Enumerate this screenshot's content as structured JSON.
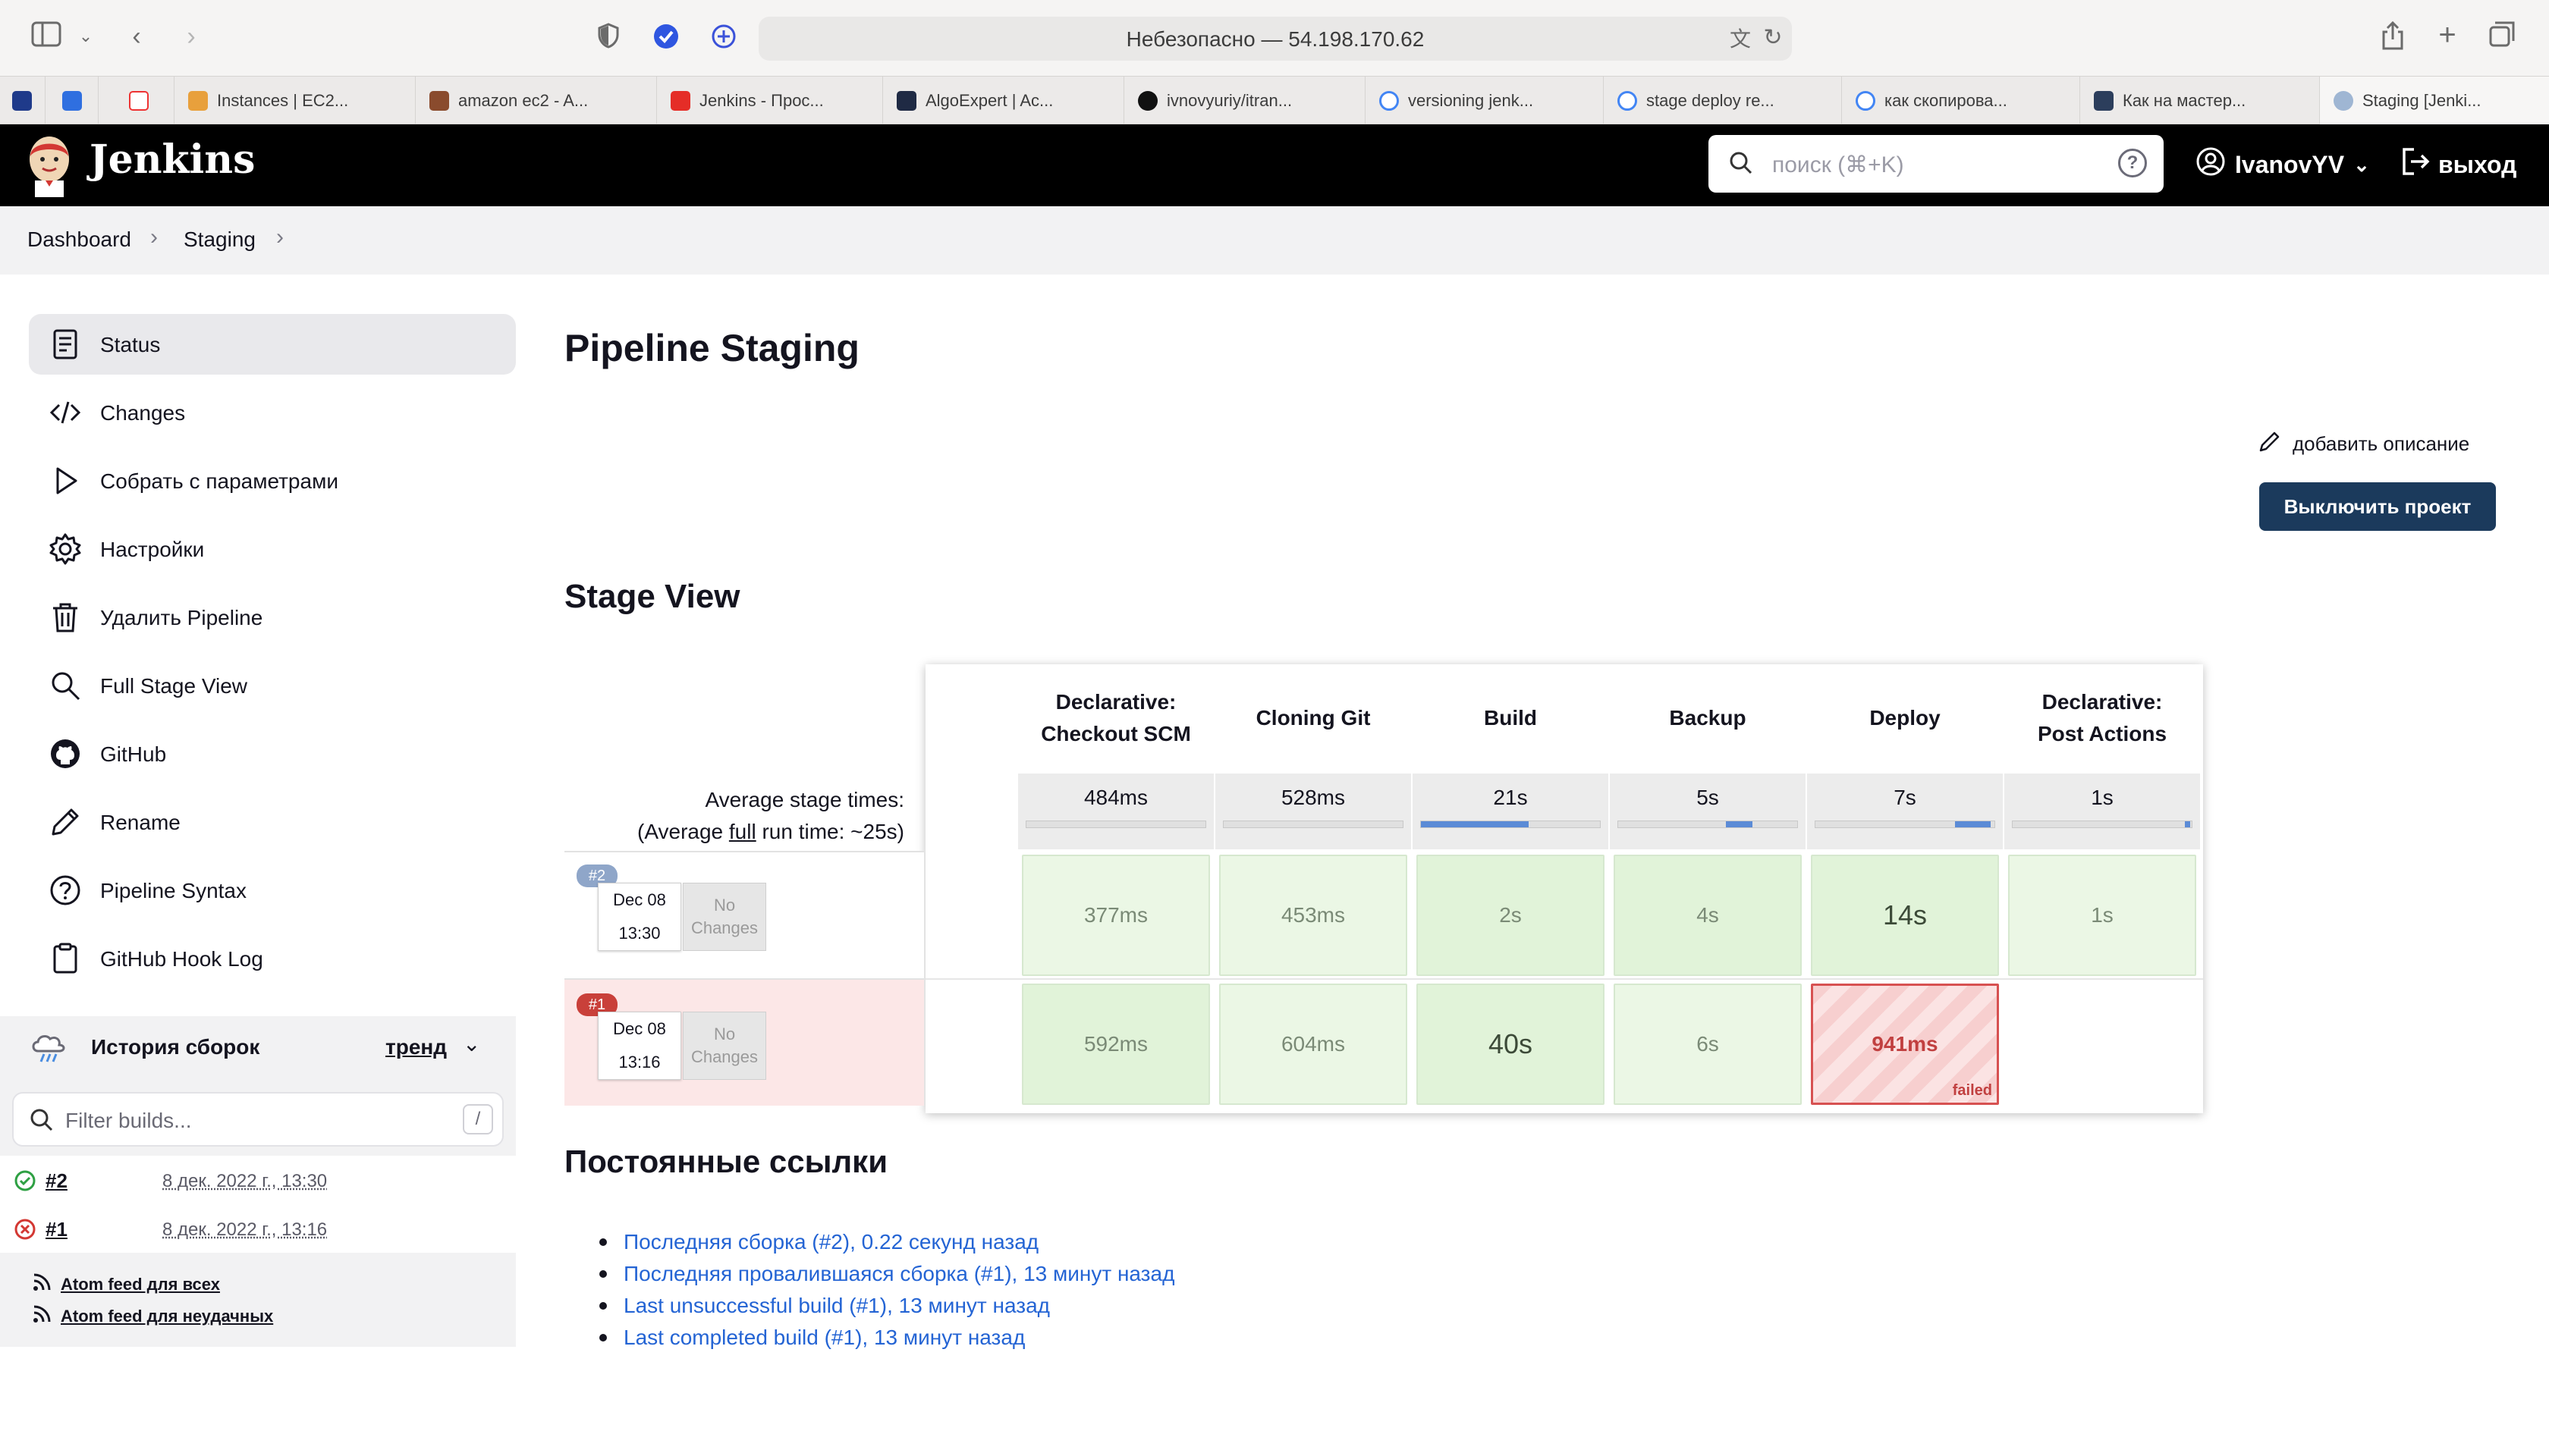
{
  "browser": {
    "url_text": "Небезопасно — 54.198.170.62",
    "bookmarks": [
      {
        "label": "Instances | EC2...",
        "color": "#e8a03c"
      },
      {
        "label": "amazon ec2 - A...",
        "color": "#8a4b2d"
      },
      {
        "label": "Jenkins - Прос...",
        "color": "#e52d27"
      },
      {
        "label": "AlgoExpert | Ac...",
        "color": "#1f2a44"
      },
      {
        "label": "ivnovyuriy/itran...",
        "color": "#111111"
      },
      {
        "label": "versioning jenk...",
        "color": "#4285f4"
      },
      {
        "label": "stage deploy re...",
        "color": "#4285f4"
      },
      {
        "label": "как скопирова...",
        "color": "#4285f4"
      },
      {
        "label": "Как на мастер...",
        "color": "#2c3e5c"
      },
      {
        "label": "Staging [Jenki...",
        "color": "#9fb6d3"
      }
    ]
  },
  "header": {
    "brand": "Jenkins",
    "search_placeholder": "поиск (⌘+K)",
    "user": "IvanovYV",
    "logout": "выход"
  },
  "breadcrumb": [
    "Dashboard",
    "Staging"
  ],
  "sidebar": {
    "items": [
      {
        "label": "Status",
        "icon": "document-icon",
        "active": true
      },
      {
        "label": "Changes",
        "icon": "code-icon"
      },
      {
        "label": "Собрать с параметрами",
        "icon": "play-icon"
      },
      {
        "label": "Настройки",
        "icon": "gear-icon"
      },
      {
        "label": "Удалить Pipeline",
        "icon": "trash-icon"
      },
      {
        "label": "Full Stage View",
        "icon": "search-icon"
      },
      {
        "label": "GitHub",
        "icon": "github-icon"
      },
      {
        "label": "Rename",
        "icon": "pencil-icon"
      },
      {
        "label": "Pipeline Syntax",
        "icon": "help-icon"
      },
      {
        "label": "GitHub Hook Log",
        "icon": "clipboard-icon"
      }
    ],
    "history": {
      "title": "История сборок",
      "trend": "тренд",
      "filter_placeholder": "Filter builds...",
      "filter_key": "/",
      "builds": [
        {
          "number": "#2",
          "date": "8 дек. 2022 г., 13:30",
          "status": "success"
        },
        {
          "number": "#1",
          "date": "8 дек. 2022 г., 13:16",
          "status": "failed"
        }
      ],
      "atom_all": "Atom feed для всех",
      "atom_failed": "Atom feed для неудачных"
    }
  },
  "main": {
    "title": "Pipeline Staging",
    "add_description": "добавить описание",
    "disable_button": "Выключить проект",
    "stage_view_title": "Stage View",
    "avg_label_line1": "Average stage times:",
    "avg_label_line2_pre": "(Average ",
    "avg_label_line2_link": "full",
    "avg_label_line2_post": " run time: ~25s)",
    "stages": [
      {
        "line1": "Declarative:",
        "line2": "Checkout SCM",
        "avg": "484ms",
        "avg_fill": 0.0
      },
      {
        "line1": "Cloning Git",
        "line2": "",
        "avg": "528ms",
        "avg_fill": 0.0
      },
      {
        "line1": "Build",
        "line2": "",
        "avg": "21s",
        "avg_fill": 0.6
      },
      {
        "line1": "Backup",
        "line2": "",
        "avg": "5s",
        "avg_fill": 0.15
      },
      {
        "line1": "Deploy",
        "line2": "",
        "avg": "7s",
        "avg_fill": 0.2
      },
      {
        "line1": "Declarative:",
        "line2": "Post Actions",
        "avg": "1s",
        "avg_fill": 0.03
      }
    ],
    "runs": [
      {
        "badge": "#2",
        "date": "Dec 08",
        "time": "13:30",
        "changes_line1": "No",
        "changes_line2": "Changes",
        "cells": [
          "377ms",
          "453ms",
          "2s",
          "4s",
          "14s",
          "1s"
        ]
      },
      {
        "badge": "#1",
        "date": "Dec 08",
        "time": "13:16",
        "changes_line1": "No",
        "changes_line2": "Changes",
        "cells": [
          "592ms",
          "604ms",
          "40s",
          "6s",
          "941ms",
          ""
        ],
        "failed_label": "failed"
      }
    ],
    "permalinks_title": "Постоянные ссылки",
    "permalinks": [
      "Последняя сборка (#2), 0.22 секунд назад",
      "Последняя провалившаяся сборка (#1), 13 минут назад",
      "Last unsuccessful build (#1), 13 минут назад",
      "Last completed build (#1), 13 минут назад"
    ]
  },
  "colors": {
    "header_bg": "#000000",
    "primary_button": "#1b3a5c",
    "link": "#2464d4",
    "success_cell": "#e1f3d9",
    "failed_cell": "#f7cfcf"
  }
}
